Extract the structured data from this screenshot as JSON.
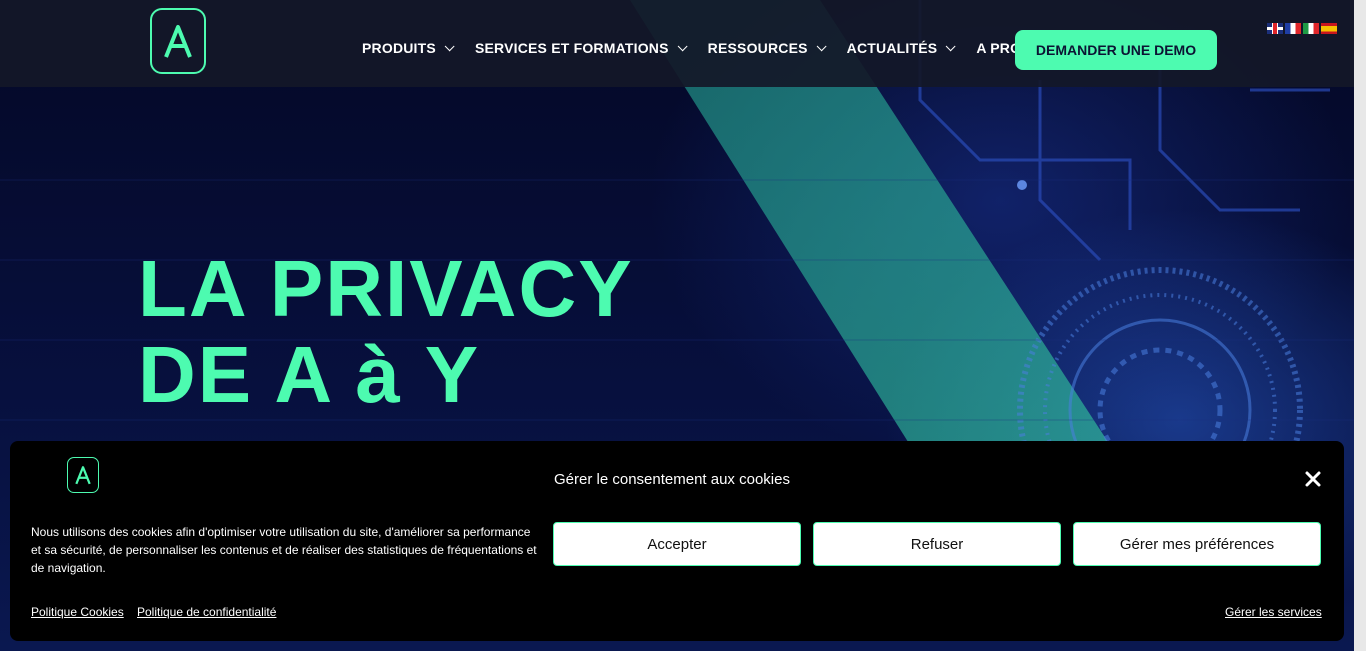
{
  "colors": {
    "accent": "#4dfbb0",
    "header_bg": "#14182a",
    "hero_bg": "#050a2e",
    "banner_bg": "#000000"
  },
  "header": {
    "logo_letter": "A",
    "nav": [
      {
        "label": "PRODUITS",
        "dropdown": true
      },
      {
        "label": "SERVICES ET FORMATIONS",
        "dropdown": true
      },
      {
        "label": "RESSOURCES",
        "dropdown": true
      },
      {
        "label": "ACTUALITÉS",
        "dropdown": true
      },
      {
        "label": "A PROPOS",
        "dropdown": false
      }
    ],
    "demo_button": "DEMANDER UNE DEMO",
    "languages": [
      "en-flag",
      "fr-flag",
      "it-flag",
      "es-flag"
    ]
  },
  "hero": {
    "title_line1": "LA PRIVACY",
    "title_line2": "DE A à Y"
  },
  "cookie_banner": {
    "logo_letter": "A",
    "title": "Gérer le consentement aux cookies",
    "text": "Nous utilisons des cookies afin d'optimiser votre utilisation du site, d'améliorer sa performance et sa sécurité, de personnaliser les contenus et de réaliser des statistiques de fréquentations et de navigation.",
    "buttons": {
      "accept": "Accepter",
      "refuse": "Refuser",
      "preferences": "Gérer mes préférences"
    },
    "links": {
      "cookie_policy": "Politique Cookies",
      "privacy_policy": "Politique de confidentialité",
      "manage_services": "Gérer les services"
    }
  }
}
